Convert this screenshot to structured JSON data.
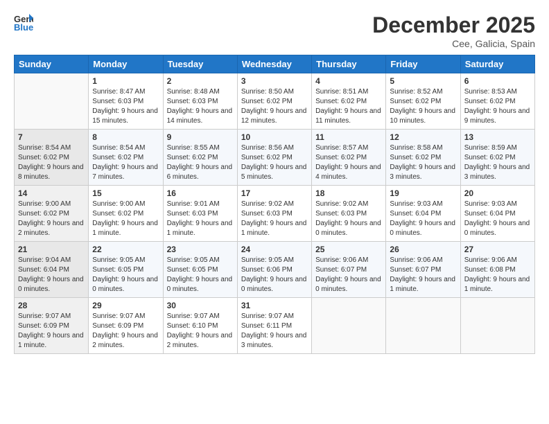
{
  "header": {
    "logo_line1": "General",
    "logo_line2": "Blue",
    "month": "December 2025",
    "location": "Cee, Galicia, Spain"
  },
  "weekdays": [
    "Sunday",
    "Monday",
    "Tuesday",
    "Wednesday",
    "Thursday",
    "Friday",
    "Saturday"
  ],
  "weeks": [
    [
      {
        "day": "",
        "sunrise": "",
        "sunset": "",
        "daylight": ""
      },
      {
        "day": "1",
        "sunrise": "Sunrise: 8:47 AM",
        "sunset": "Sunset: 6:03 PM",
        "daylight": "Daylight: 9 hours and 15 minutes."
      },
      {
        "day": "2",
        "sunrise": "Sunrise: 8:48 AM",
        "sunset": "Sunset: 6:03 PM",
        "daylight": "Daylight: 9 hours and 14 minutes."
      },
      {
        "day": "3",
        "sunrise": "Sunrise: 8:50 AM",
        "sunset": "Sunset: 6:02 PM",
        "daylight": "Daylight: 9 hours and 12 minutes."
      },
      {
        "day": "4",
        "sunrise": "Sunrise: 8:51 AM",
        "sunset": "Sunset: 6:02 PM",
        "daylight": "Daylight: 9 hours and 11 minutes."
      },
      {
        "day": "5",
        "sunrise": "Sunrise: 8:52 AM",
        "sunset": "Sunset: 6:02 PM",
        "daylight": "Daylight: 9 hours and 10 minutes."
      },
      {
        "day": "6",
        "sunrise": "Sunrise: 8:53 AM",
        "sunset": "Sunset: 6:02 PM",
        "daylight": "Daylight: 9 hours and 9 minutes."
      }
    ],
    [
      {
        "day": "7",
        "sunrise": "Sunrise: 8:54 AM",
        "sunset": "Sunset: 6:02 PM",
        "daylight": "Daylight: 9 hours and 8 minutes."
      },
      {
        "day": "8",
        "sunrise": "Sunrise: 8:54 AM",
        "sunset": "Sunset: 6:02 PM",
        "daylight": "Daylight: 9 hours and 7 minutes."
      },
      {
        "day": "9",
        "sunrise": "Sunrise: 8:55 AM",
        "sunset": "Sunset: 6:02 PM",
        "daylight": "Daylight: 9 hours and 6 minutes."
      },
      {
        "day": "10",
        "sunrise": "Sunrise: 8:56 AM",
        "sunset": "Sunset: 6:02 PM",
        "daylight": "Daylight: 9 hours and 5 minutes."
      },
      {
        "day": "11",
        "sunrise": "Sunrise: 8:57 AM",
        "sunset": "Sunset: 6:02 PM",
        "daylight": "Daylight: 9 hours and 4 minutes."
      },
      {
        "day": "12",
        "sunrise": "Sunrise: 8:58 AM",
        "sunset": "Sunset: 6:02 PM",
        "daylight": "Daylight: 9 hours and 3 minutes."
      },
      {
        "day": "13",
        "sunrise": "Sunrise: 8:59 AM",
        "sunset": "Sunset: 6:02 PM",
        "daylight": "Daylight: 9 hours and 3 minutes."
      }
    ],
    [
      {
        "day": "14",
        "sunrise": "Sunrise: 9:00 AM",
        "sunset": "Sunset: 6:02 PM",
        "daylight": "Daylight: 9 hours and 2 minutes."
      },
      {
        "day": "15",
        "sunrise": "Sunrise: 9:00 AM",
        "sunset": "Sunset: 6:02 PM",
        "daylight": "Daylight: 9 hours and 1 minute."
      },
      {
        "day": "16",
        "sunrise": "Sunrise: 9:01 AM",
        "sunset": "Sunset: 6:03 PM",
        "daylight": "Daylight: 9 hours and 1 minute."
      },
      {
        "day": "17",
        "sunrise": "Sunrise: 9:02 AM",
        "sunset": "Sunset: 6:03 PM",
        "daylight": "Daylight: 9 hours and 1 minute."
      },
      {
        "day": "18",
        "sunrise": "Sunrise: 9:02 AM",
        "sunset": "Sunset: 6:03 PM",
        "daylight": "Daylight: 9 hours and 0 minutes."
      },
      {
        "day": "19",
        "sunrise": "Sunrise: 9:03 AM",
        "sunset": "Sunset: 6:04 PM",
        "daylight": "Daylight: 9 hours and 0 minutes."
      },
      {
        "day": "20",
        "sunrise": "Sunrise: 9:03 AM",
        "sunset": "Sunset: 6:04 PM",
        "daylight": "Daylight: 9 hours and 0 minutes."
      }
    ],
    [
      {
        "day": "21",
        "sunrise": "Sunrise: 9:04 AM",
        "sunset": "Sunset: 6:04 PM",
        "daylight": "Daylight: 9 hours and 0 minutes."
      },
      {
        "day": "22",
        "sunrise": "Sunrise: 9:05 AM",
        "sunset": "Sunset: 6:05 PM",
        "daylight": "Daylight: 9 hours and 0 minutes."
      },
      {
        "day": "23",
        "sunrise": "Sunrise: 9:05 AM",
        "sunset": "Sunset: 6:05 PM",
        "daylight": "Daylight: 9 hours and 0 minutes."
      },
      {
        "day": "24",
        "sunrise": "Sunrise: 9:05 AM",
        "sunset": "Sunset: 6:06 PM",
        "daylight": "Daylight: 9 hours and 0 minutes."
      },
      {
        "day": "25",
        "sunrise": "Sunrise: 9:06 AM",
        "sunset": "Sunset: 6:07 PM",
        "daylight": "Daylight: 9 hours and 0 minutes."
      },
      {
        "day": "26",
        "sunrise": "Sunrise: 9:06 AM",
        "sunset": "Sunset: 6:07 PM",
        "daylight": "Daylight: 9 hours and 1 minute."
      },
      {
        "day": "27",
        "sunrise": "Sunrise: 9:06 AM",
        "sunset": "Sunset: 6:08 PM",
        "daylight": "Daylight: 9 hours and 1 minute."
      }
    ],
    [
      {
        "day": "28",
        "sunrise": "Sunrise: 9:07 AM",
        "sunset": "Sunset: 6:09 PM",
        "daylight": "Daylight: 9 hours and 1 minute."
      },
      {
        "day": "29",
        "sunrise": "Sunrise: 9:07 AM",
        "sunset": "Sunset: 6:09 PM",
        "daylight": "Daylight: 9 hours and 2 minutes."
      },
      {
        "day": "30",
        "sunrise": "Sunrise: 9:07 AM",
        "sunset": "Sunset: 6:10 PM",
        "daylight": "Daylight: 9 hours and 2 minutes."
      },
      {
        "day": "31",
        "sunrise": "Sunrise: 9:07 AM",
        "sunset": "Sunset: 6:11 PM",
        "daylight": "Daylight: 9 hours and 3 minutes."
      },
      {
        "day": "",
        "sunrise": "",
        "sunset": "",
        "daylight": ""
      },
      {
        "day": "",
        "sunrise": "",
        "sunset": "",
        "daylight": ""
      },
      {
        "day": "",
        "sunrise": "",
        "sunset": "",
        "daylight": ""
      }
    ]
  ]
}
